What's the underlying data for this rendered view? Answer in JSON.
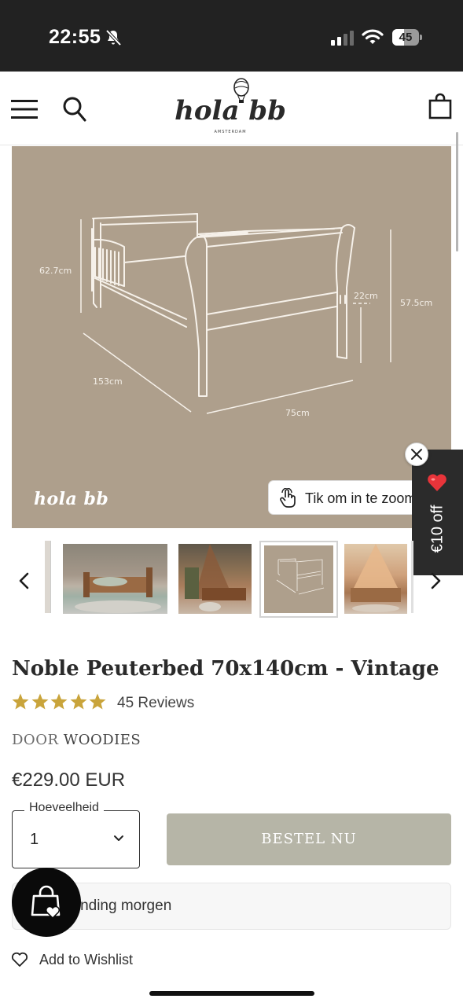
{
  "status_bar": {
    "time": "22:55",
    "battery": "45"
  },
  "header": {
    "logo_text": "hola bb",
    "logo_subtext": "AMSTERDAM"
  },
  "gallery": {
    "watermark": "hola bb",
    "zoom_hint": "Tik om in te zoomen",
    "dimensions": {
      "height_left": "62.7cm",
      "length": "153cm",
      "width": "75cm",
      "side_rail": "22cm",
      "height_right": "57.5cm"
    },
    "thumbnail_count": 4,
    "selected_thumbnail": 3
  },
  "promo": {
    "label": "€10 off"
  },
  "product": {
    "title": "Noble Peuterbed 70x140cm - Vintage",
    "rating": 5,
    "reviews_label": "45 Reviews",
    "brand_prefix": "DOOR",
    "brand": "WOODIES",
    "price": "€229.00 EUR"
  },
  "purchase": {
    "quantity_label": "Hoeveelheid",
    "quantity_value": "1",
    "order_button": "BESTEL NU"
  },
  "shipping": {
    "text": "zending morgen"
  },
  "wishlist": {
    "label": "Add to Wishlist"
  },
  "colors": {
    "accent_gold": "#c9a43b",
    "gallery_bg": "#ae9f8c",
    "order_button_bg": "#b6b5a7"
  }
}
